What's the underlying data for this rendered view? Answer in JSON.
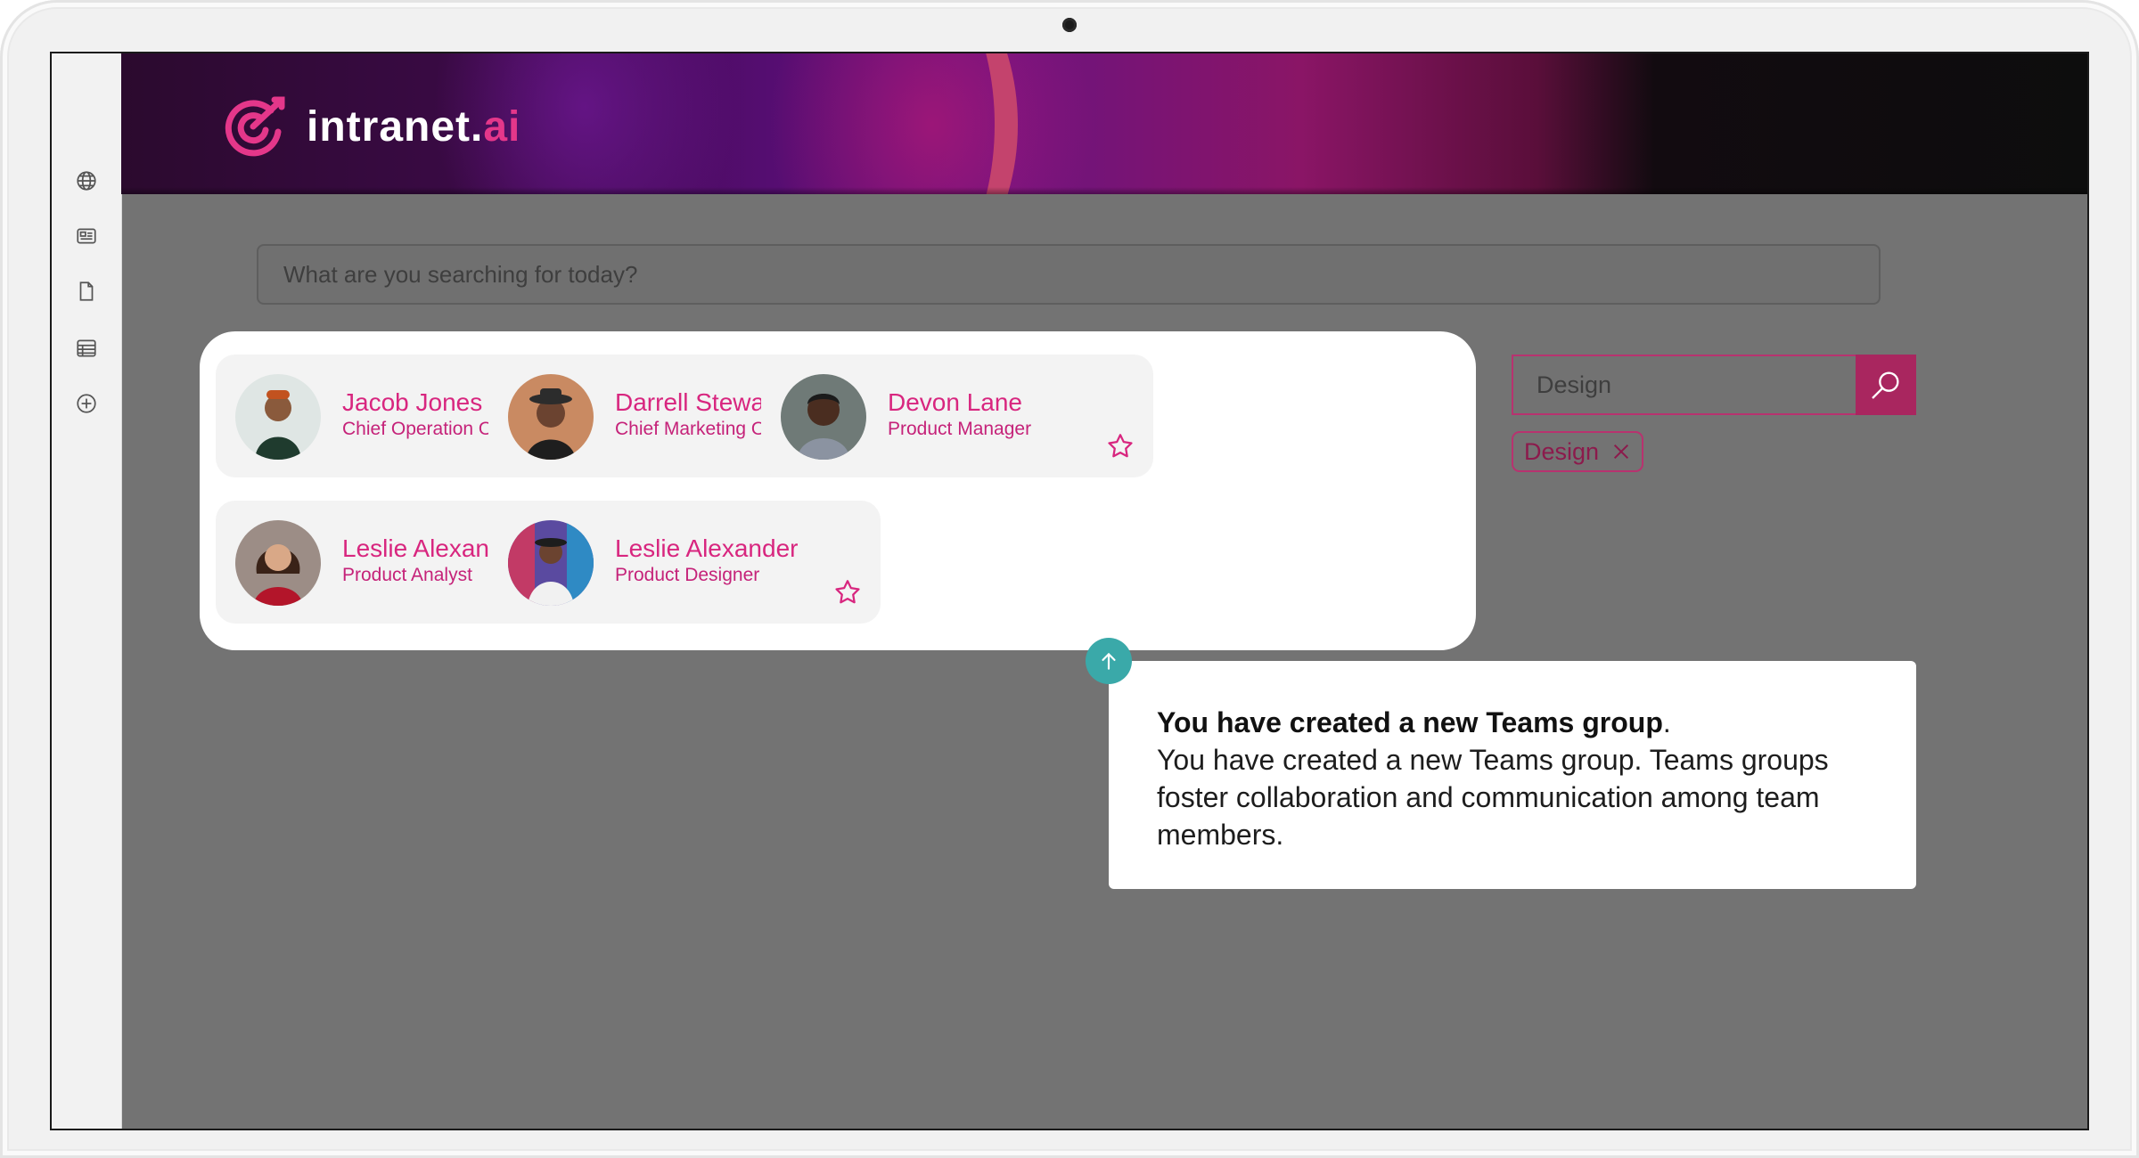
{
  "app": {
    "brand_name": "intranet.",
    "brand_accent": "ai",
    "brand_color": "#e4378a"
  },
  "rail": {
    "icons": [
      "globe-icon",
      "news-icon",
      "document-icon",
      "table-icon",
      "add-circle-icon"
    ]
  },
  "search": {
    "placeholder": "What are you searching for today?"
  },
  "people": [
    {
      "name": "Jacob Jones",
      "role": "Chief Operation Officer"
    },
    {
      "name": "Darrell Steward",
      "role": "Chief Marketing Officer"
    },
    {
      "name": "Devon Lane",
      "role": "Product Manager"
    },
    {
      "name": "Leslie Alexander",
      "role": "Product Analyst"
    },
    {
      "name": "Leslie Alexander",
      "role": "Product Designer"
    }
  ],
  "filter": {
    "value": "Design",
    "chips": [
      "Design"
    ],
    "accent": "#a9265f"
  },
  "notification": {
    "title": "You have created a new Teams group",
    "title_suffix": ".",
    "body": "You have created a new Teams group. Teams groups foster collaboration and communication among team members.",
    "badge_color": "#3aa9a9"
  }
}
